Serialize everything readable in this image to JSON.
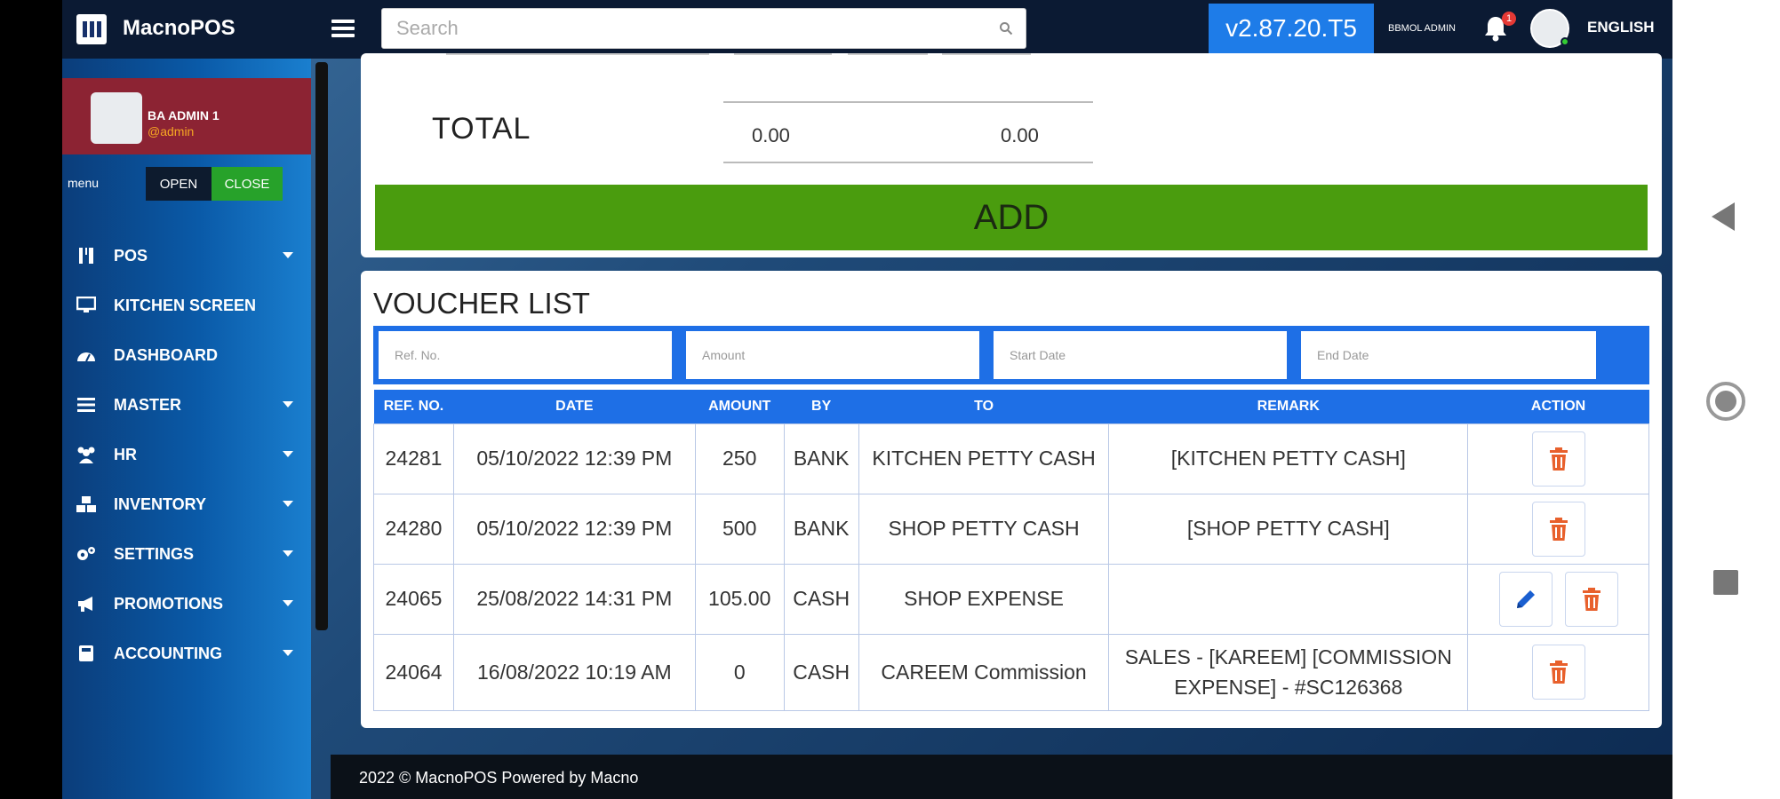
{
  "app": {
    "name": "MacnoPOS",
    "version": "v2.87.20.T5",
    "user_label": "BBMOL ADMIN",
    "notification_count": "1",
    "language": "ENGLISH"
  },
  "search": {
    "placeholder": "Search"
  },
  "profile": {
    "name": "BA ADMIN 1",
    "handle": "@admin"
  },
  "menu_toggle": {
    "label": "menu",
    "open": "OPEN",
    "close": "CLOSE"
  },
  "sidebar": {
    "items": [
      {
        "label": "POS",
        "icon": "pos-icon",
        "has_submenu": true
      },
      {
        "label": "KITCHEN SCREEN",
        "icon": "monitor-icon",
        "has_submenu": false
      },
      {
        "label": "DASHBOARD",
        "icon": "dashboard-icon",
        "has_submenu": false
      },
      {
        "label": "MASTER",
        "icon": "list-icon",
        "has_submenu": true
      },
      {
        "label": "HR",
        "icon": "users-icon",
        "has_submenu": true
      },
      {
        "label": "INVENTORY",
        "icon": "boxes-icon",
        "has_submenu": true
      },
      {
        "label": "SETTINGS",
        "icon": "gears-icon",
        "has_submenu": true
      },
      {
        "label": "PROMOTIONS",
        "icon": "megaphone-icon",
        "has_submenu": true
      },
      {
        "label": "ACCOUNTING",
        "icon": "calculator-icon",
        "has_submenu": true
      }
    ]
  },
  "totals": {
    "label": "TOTAL",
    "value1": "0.00",
    "value2": "0.00"
  },
  "add_button": "ADD",
  "voucher_list": {
    "title": "VOUCHER LIST",
    "filters": {
      "ref": "Ref. No.",
      "amount": "Amount",
      "start": "Start Date",
      "end": "End Date"
    },
    "columns": [
      "REF. NO.",
      "DATE",
      "AMOUNT",
      "BY",
      "TO",
      "REMARK",
      "ACTION"
    ],
    "rows": [
      {
        "ref": "24281",
        "date": "05/10/2022 12:39 PM",
        "amount": "250",
        "by": "BANK",
        "to": "KITCHEN PETTY CASH",
        "remark": "[KITCHEN PETTY CASH]",
        "editable": false
      },
      {
        "ref": "24280",
        "date": "05/10/2022 12:39 PM",
        "amount": "500",
        "by": "BANK",
        "to": "SHOP PETTY CASH",
        "remark": "[SHOP PETTY CASH]",
        "editable": false
      },
      {
        "ref": "24065",
        "date": "25/08/2022 14:31 PM",
        "amount": "105.00",
        "by": "CASH",
        "to": "SHOP EXPENSE",
        "remark": "",
        "editable": true
      },
      {
        "ref": "24064",
        "date": "16/08/2022 10:19 AM",
        "amount": "0",
        "by": "CASH",
        "to": "CAREEM Commission",
        "remark": "SALES - [KAREEM] [COMMISSION EXPENSE] - #SC126368",
        "editable": false
      }
    ]
  },
  "footer": "2022 © MacnoPOS Powered by Macno",
  "colors": {
    "accent_blue": "#1e6fe6",
    "add_green": "#4a9c0e",
    "profile_red": "#8c2333",
    "delete_orange": "#e8602c",
    "edit_blue": "#1a5fd0"
  }
}
